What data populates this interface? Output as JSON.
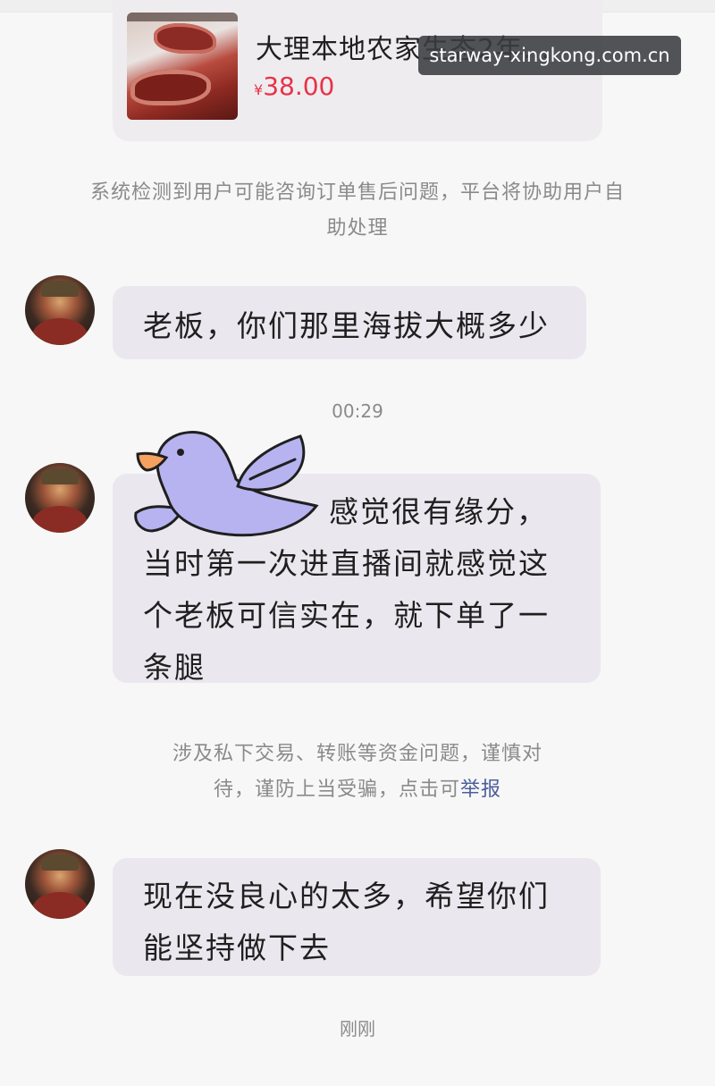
{
  "watermark": "starway-xingkong.com.cn",
  "product": {
    "title": "大理本地农家生态2年…",
    "price_symbol": "¥",
    "price": "38.00",
    "image_icon": "cured-ham-image"
  },
  "messages": [
    {
      "type": "system",
      "text": "系统检测到用户可能咨询订单售后问题，平台将协助用户自助处理"
    },
    {
      "type": "user",
      "avatar_icon": "user-avatar",
      "lines": [
        "老板，你们那里海拔大概多少"
      ]
    },
    {
      "type": "time",
      "text": "00:29"
    },
    {
      "type": "user",
      "avatar_icon": "user-avatar",
      "lines": [
        "感觉很有缘分，",
        "当时第一次进直播间就感觉这",
        "个老板可信实在，就下单了一",
        "条腿"
      ]
    },
    {
      "type": "system",
      "lines": [
        "涉及私下交易、转账等资金问题，谨慎对",
        "待，谨防上当受骗，点击可"
      ],
      "link_text": "举报"
    },
    {
      "type": "user",
      "avatar_icon": "user-avatar",
      "lines": [
        "现在没良心的太多，希望你们",
        "能坚持做下去"
      ]
    },
    {
      "type": "time",
      "text": "刚刚"
    }
  ],
  "sticker_icon": "purple-bird-sticker",
  "colors": {
    "price": "#e6334a",
    "bubble": "#ebe7ee",
    "system_text": "#8a8a8a",
    "link": "#4c5f9c",
    "bird": "#b6b3f0"
  }
}
